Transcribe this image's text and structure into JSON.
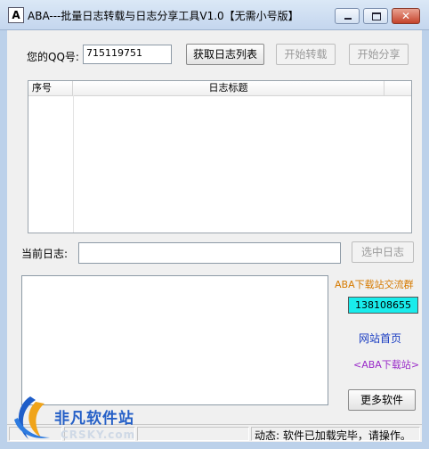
{
  "window": {
    "title": "ABA---批量日志转载与日志分享工具V1.0【无需小号版】",
    "app_icon_glyph": "A",
    "close_glyph": "✕"
  },
  "form": {
    "qq_label": "您的QQ号:",
    "qq_value": "715119751",
    "get_list_button": "获取日志列表",
    "start_repost_button": "开始转载",
    "start_share_button": "开始分享"
  },
  "log_list": {
    "columns": [
      "序号",
      "日志标题"
    ]
  },
  "current_log": {
    "label": "当前日志:",
    "value": "",
    "select_button": "选中日志"
  },
  "side": {
    "qq_group_label": "ABA下载站交流群",
    "qq_group_number": "138108655",
    "home_link": "网站首页",
    "aba_link": "<ABA下载站>",
    "more_software_button": "更多软件"
  },
  "statusbar": {
    "status_text": "动态: 软件已加载完毕，请操作。"
  },
  "watermark": {
    "text": "非凡软件站",
    "url": "CRSKY.com"
  },
  "colors": {
    "qq_group_text": "#d67a00",
    "qq_number_bg": "#19ecec",
    "home_link": "#1a3dc2",
    "aba_link": "#9a2bc9",
    "title_bar": "#c4d6ee"
  }
}
